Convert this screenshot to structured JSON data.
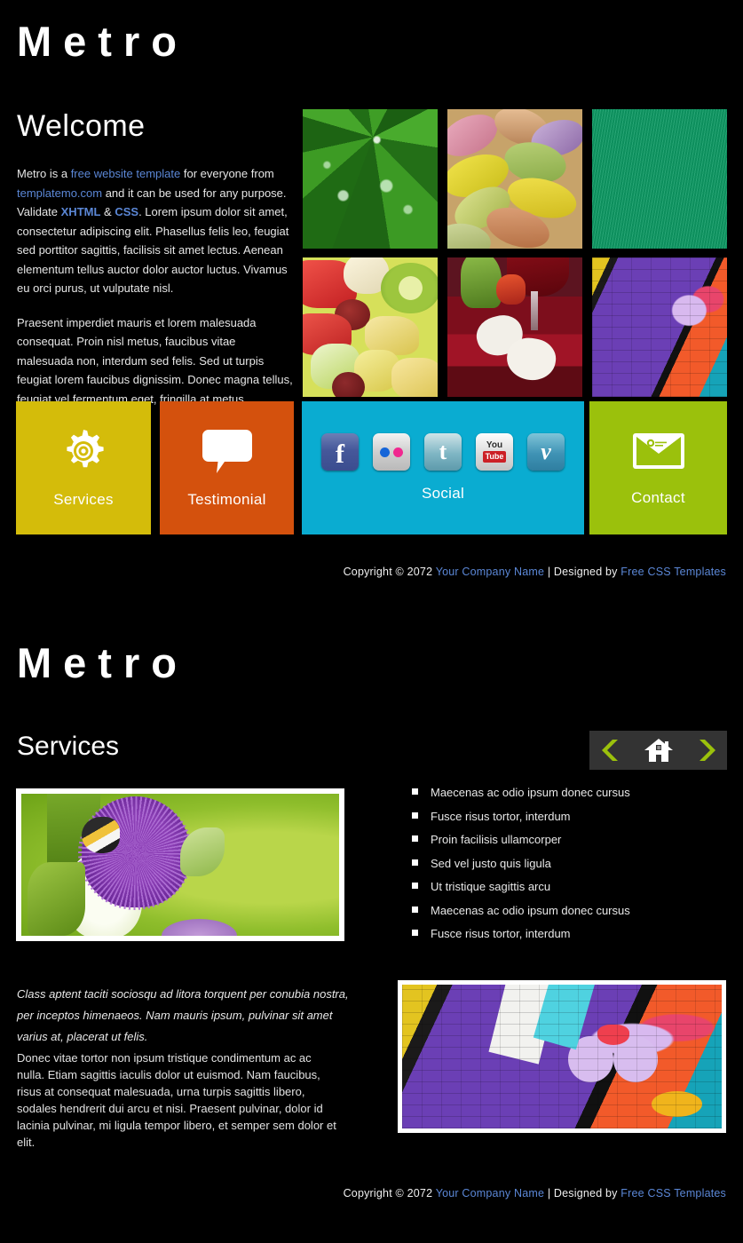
{
  "site": {
    "logo": "Metro"
  },
  "home": {
    "heading": "Welcome",
    "paragraph1": {
      "part1": "Metro is a ",
      "link1": "free website template",
      "part2": " for everyone from ",
      "link2": "templatemo.com",
      "part3": " and it can be used for any purpose. Validate ",
      "link3": "XHTML",
      "part4": " & ",
      "link4": "CSS",
      "part5": ". Lorem ipsum dolor sit amet, consectetur adipiscing elit. Phasellus felis leo, feugiat sed porttitor sagittis, facilisis sit amet lectus. Aenean elementum tellus auctor dolor auctor luctus. Vivamus eu orci purus, ut vulputate nisl."
    },
    "paragraph2": "Praesent imperdiet mauris et lorem malesuada consequat. Proin nisl metus, faucibus vitae malesuada non, interdum sed felis. Sed ut turpis feugiat lorem faucibus dignissim. Donec magna tellus, feugiat vel fermentum eget, fringilla at metus.",
    "gallery": [
      {
        "name": "green-leaf-with-dewdrops"
      },
      {
        "name": "colored-candy-pebbles"
      },
      {
        "name": "colored-thread-spools"
      },
      {
        "name": "fresh-fruit-salad"
      },
      {
        "name": "wine-glasses-with-hearts"
      },
      {
        "name": "purple-graffiti-wall"
      }
    ]
  },
  "tiles": [
    {
      "label": "Services",
      "icon": "gear-icon",
      "color": "#d4bc0a"
    },
    {
      "label": "Testimonial",
      "icon": "speech-bubble-icon",
      "color": "#d4510d"
    },
    {
      "label": "Social",
      "icon": "social-icons",
      "color": "#0aacd1"
    },
    {
      "label": "Contact",
      "icon": "envelope-icon",
      "color": "#9bc10c"
    }
  ],
  "social_icons": [
    {
      "name": "facebook-icon",
      "label": "f"
    },
    {
      "name": "flickr-icon",
      "label": ""
    },
    {
      "name": "twitter-icon",
      "label": "t"
    },
    {
      "name": "youtube-icon",
      "label_top": "You",
      "label_bottom": "Tube"
    },
    {
      "name": "vimeo-icon",
      "label": "v"
    }
  ],
  "services": {
    "heading": "Services",
    "nav": {
      "prev": "prev-arrow",
      "home": "home-icon",
      "next": "next-arrow"
    },
    "photo_main": "bee-on-purple-thistle",
    "photo_secondary": "graffiti-do-what-you-love",
    "list": [
      "Maecenas ac odio ipsum donec cursus",
      "Fusce risus tortor, interdum",
      "Proin facilisis ullamcorper",
      "Sed vel justo quis ligula",
      "Ut tristique sagittis arcu",
      "Maecenas ac odio ipsum donec cursus",
      "Fusce risus tortor, interdum"
    ],
    "italic_paragraph": "Class aptent taciti sociosqu ad litora torquent per conubia nostra, per inceptos himenaeos. Nam mauris ipsum, pulvinar sit amet varius at, placerat ut felis.",
    "body_paragraph": "Donec vitae tortor non ipsum tristique condimentum ac ac nulla. Etiam sagittis iaculis dolor ut euismod. Nam faucibus, risus at consequat malesuada, urna turpis sagittis libero, sodales hendrerit dui arcu et nisi. Praesent pulvinar, dolor id lacinia pulvinar, mi ligula tempor libero, et semper sem dolor et elit."
  },
  "footer": {
    "copyright": "Copyright © 2072 ",
    "company": "Your Company Name",
    "separator": " | Designed by ",
    "designer": "Free CSS Templates"
  },
  "colors": {
    "background": "#000000",
    "link": "#5b87d6",
    "accent_green": "#9bc10c",
    "navbar": "#333333"
  }
}
